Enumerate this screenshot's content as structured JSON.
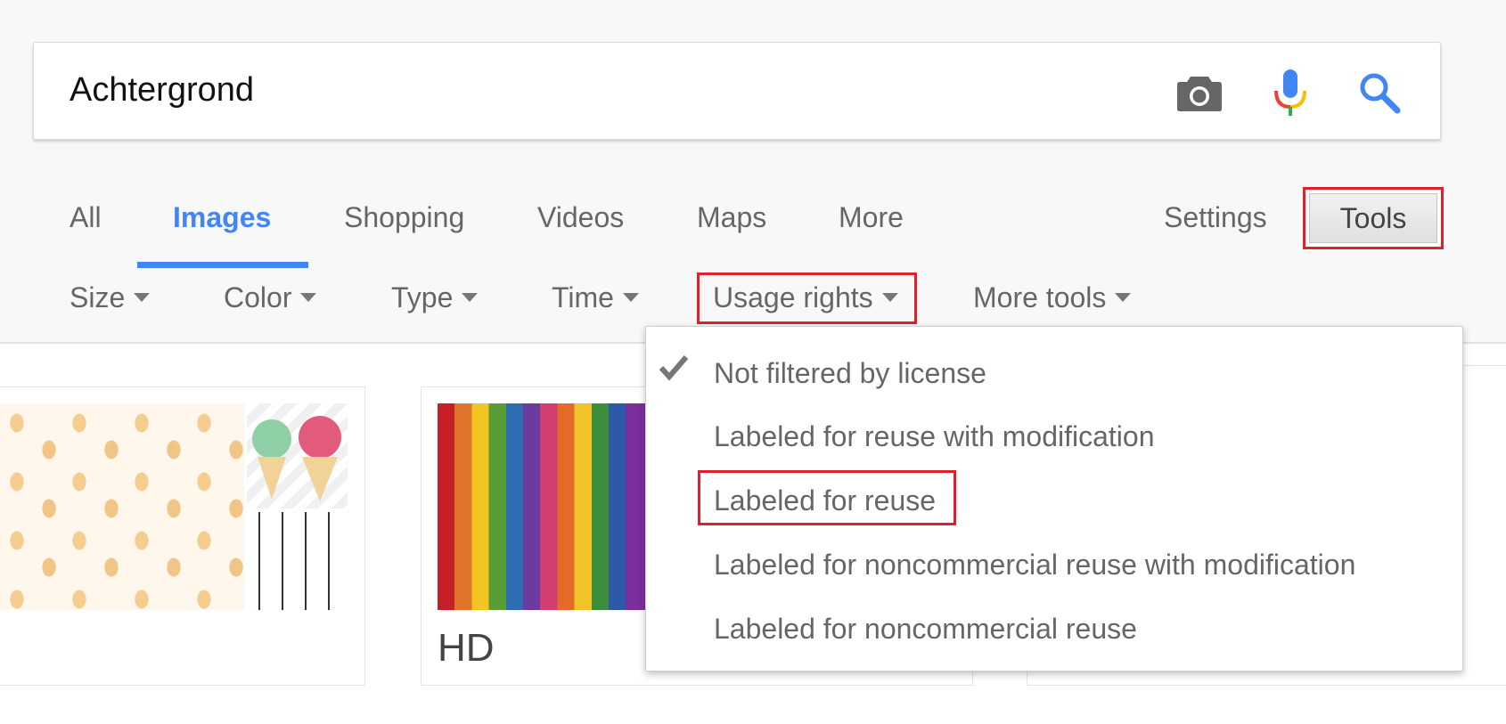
{
  "search": {
    "query": "Achtergrond"
  },
  "tabs": [
    {
      "label": "All"
    },
    {
      "label": "Images"
    },
    {
      "label": "Shopping"
    },
    {
      "label": "Videos"
    },
    {
      "label": "Maps"
    },
    {
      "label": "More"
    }
  ],
  "settings_label": "Settings",
  "tools_label": "Tools",
  "tools_row": [
    {
      "label": "Size"
    },
    {
      "label": "Color"
    },
    {
      "label": "Type"
    },
    {
      "label": "Time"
    },
    {
      "label": "Usage rights"
    },
    {
      "label": "More tools"
    }
  ],
  "usage_menu": {
    "items": [
      {
        "label": "Not filtered by license",
        "checked": true
      },
      {
        "label": "Labeled for reuse with modification"
      },
      {
        "label": "Labeled for reuse"
      },
      {
        "label": "Labeled for noncommercial reuse with modification"
      },
      {
        "label": "Labeled for noncommercial reuse"
      }
    ]
  },
  "results": {
    "card2_caption": "HD"
  },
  "colors": {
    "accent": "#4285f4",
    "highlight": "#e0202a"
  },
  "icons": {
    "camera": "camera-icon",
    "mic": "mic-icon",
    "search": "search-icon",
    "check": "check-icon",
    "caret": "caret-down-icon"
  }
}
